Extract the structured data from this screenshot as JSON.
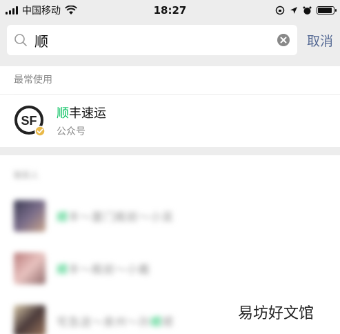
{
  "status_bar": {
    "carrier": "中国移动",
    "time": "18:27",
    "battery_level": 0.9
  },
  "search": {
    "query": "顺",
    "cancel_label": "取消"
  },
  "sections": {
    "frequent_header": "最常使用",
    "contacts_header": "联系人"
  },
  "frequent_result": {
    "title_highlight": "顺",
    "title_rest": "丰速运",
    "subtitle": "公众号",
    "logo_text": "SF"
  },
  "contacts": [
    {
      "highlight": "顺",
      "text": "丰～厦门殿前～小吴"
    },
    {
      "highlight": "顺",
      "text": "丰～殿前～小戴"
    },
    {
      "prefix": "宅急送～泉州～孙",
      "highlight": "顺",
      "text": "顺"
    }
  ],
  "watermark": "易坊好文馆",
  "colors": {
    "highlight": "#07c160",
    "link": "#576b95",
    "background": "#ededed"
  }
}
